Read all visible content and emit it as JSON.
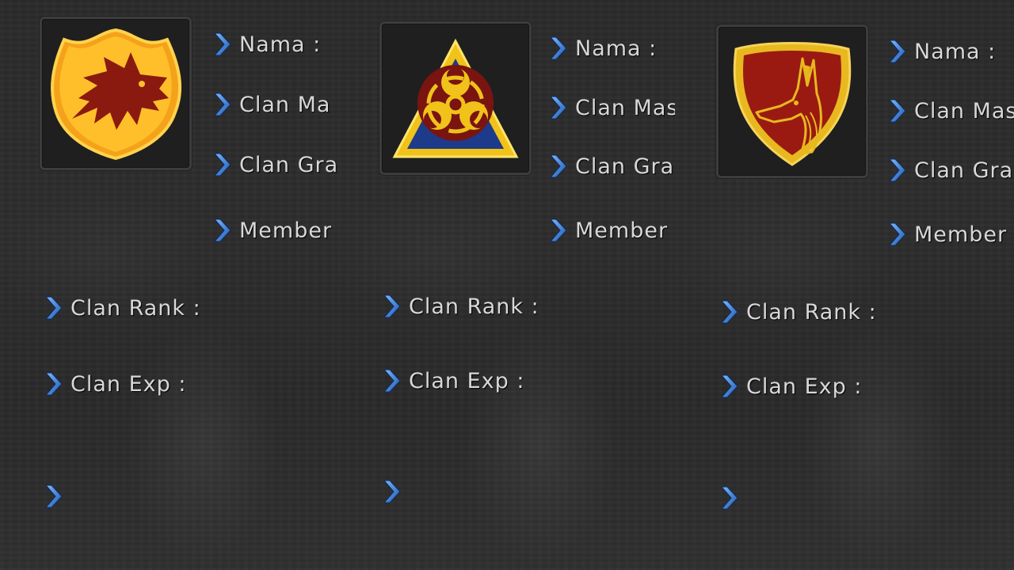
{
  "panels": [
    {
      "emblem": "wolf-crest-icon",
      "colors": {
        "primary": "#f5a21b",
        "secondary": "#8a1a10"
      },
      "labels": {
        "nama": "Nama :",
        "clan_master": "Clan Ma",
        "clan_grade": "Clan Gra",
        "member": "Member",
        "clan_rank": "Clan Rank :",
        "clan_exp": "Clan Exp :"
      }
    },
    {
      "emblem": "biohazard-icon",
      "colors": {
        "primary": "#f0c21a",
        "secondary": "#7a1410"
      },
      "labels": {
        "nama": "Nama :",
        "clan_master": "Clan Mas",
        "clan_grade": "Clan Gra",
        "member": "Member",
        "clan_rank": "Clan Rank :",
        "clan_exp": "Clan Exp :"
      }
    },
    {
      "emblem": "anubis-shield-icon",
      "colors": {
        "primary": "#e8b81f",
        "secondary": "#9a1a12"
      },
      "labels": {
        "nama": "Nama :",
        "clan_master": "Clan Mas",
        "clan_grade": "Clan Gra",
        "member": "Member",
        "clan_rank": "Clan Rank :",
        "clan_exp": "Clan Exp :"
      }
    }
  ],
  "accent_color": "#3a7fd0"
}
